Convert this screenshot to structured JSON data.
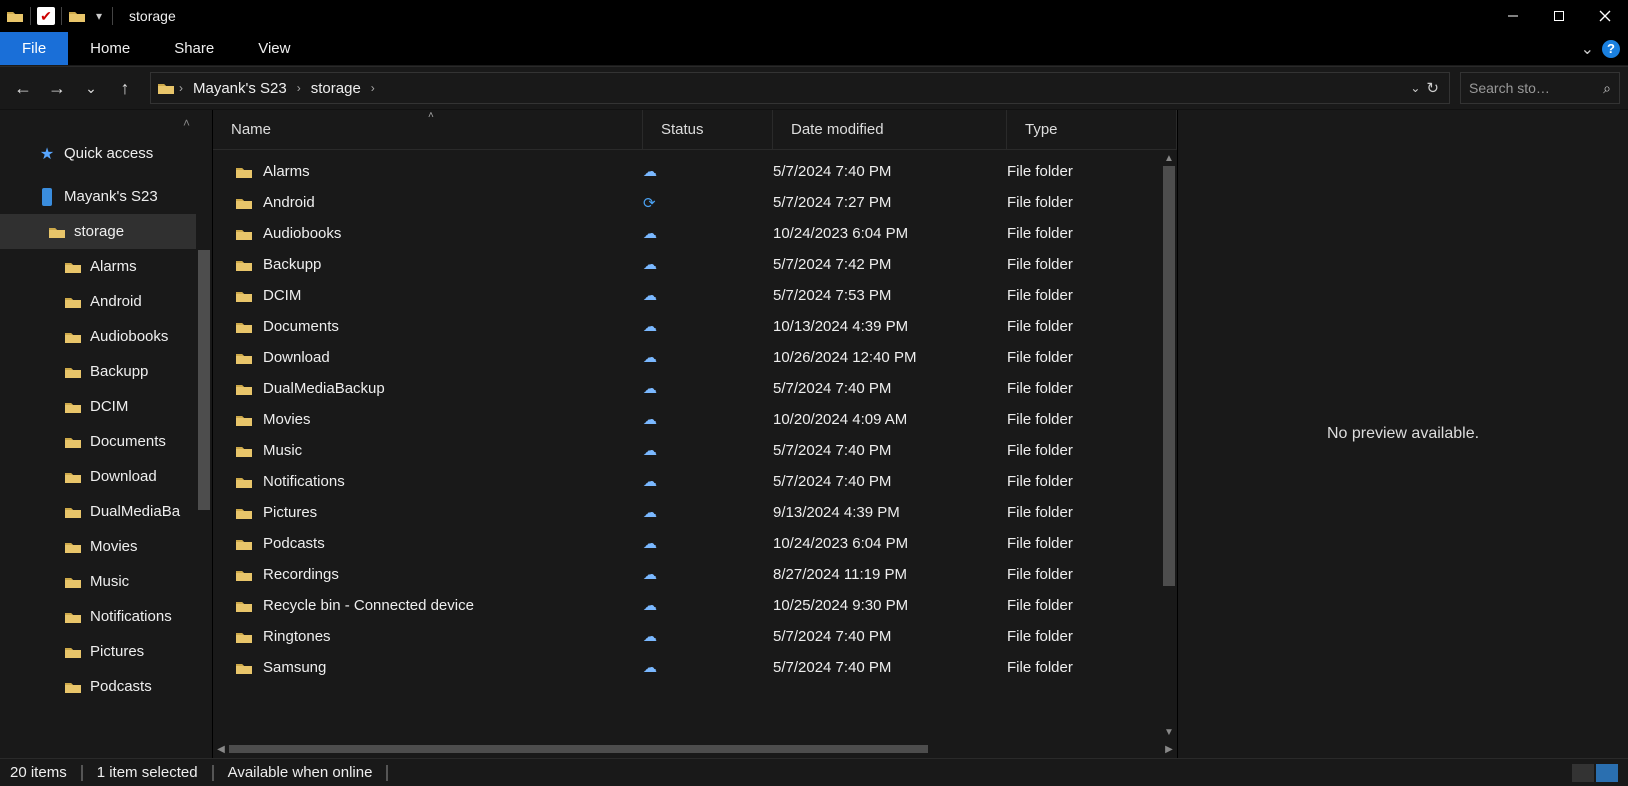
{
  "window": {
    "title": "storage"
  },
  "ribbon": {
    "file": "File",
    "tabs": [
      "Home",
      "Share",
      "View"
    ]
  },
  "breadcrumb": [
    "Mayank's S23",
    "storage"
  ],
  "search_placeholder": "Search sto…",
  "sidebar": {
    "quick_access": "Quick access",
    "device": "Mayank's S23",
    "storage": "storage",
    "children": [
      "Alarms",
      "Android",
      "Audiobooks",
      "Backupp",
      "DCIM",
      "Documents",
      "Download",
      "DualMediaBa",
      "Movies",
      "Music",
      "Notifications",
      "Pictures",
      "Podcasts"
    ]
  },
  "columns": {
    "name": "Name",
    "status": "Status",
    "date": "Date modified",
    "type": "Type"
  },
  "rows": [
    {
      "name": "Alarms",
      "status": "cloud",
      "date": "5/7/2024 7:40 PM",
      "type": "File folder"
    },
    {
      "name": "Android",
      "status": "sync",
      "date": "5/7/2024 7:27 PM",
      "type": "File folder"
    },
    {
      "name": "Audiobooks",
      "status": "cloud",
      "date": "10/24/2023 6:04 PM",
      "type": "File folder"
    },
    {
      "name": "Backupp",
      "status": "cloud",
      "date": "5/7/2024 7:42 PM",
      "type": "File folder"
    },
    {
      "name": "DCIM",
      "status": "cloud",
      "date": "5/7/2024 7:53 PM",
      "type": "File folder"
    },
    {
      "name": "Documents",
      "status": "cloud",
      "date": "10/13/2024 4:39 PM",
      "type": "File folder"
    },
    {
      "name": "Download",
      "status": "cloud",
      "date": "10/26/2024 12:40 PM",
      "type": "File folder"
    },
    {
      "name": "DualMediaBackup",
      "status": "cloud",
      "date": "5/7/2024 7:40 PM",
      "type": "File folder"
    },
    {
      "name": "Movies",
      "status": "cloud",
      "date": "10/20/2024 4:09 AM",
      "type": "File folder"
    },
    {
      "name": "Music",
      "status": "cloud",
      "date": "5/7/2024 7:40 PM",
      "type": "File folder"
    },
    {
      "name": "Notifications",
      "status": "cloud",
      "date": "5/7/2024 7:40 PM",
      "type": "File folder"
    },
    {
      "name": "Pictures",
      "status": "cloud",
      "date": "9/13/2024 4:39 PM",
      "type": "File folder"
    },
    {
      "name": "Podcasts",
      "status": "cloud",
      "date": "10/24/2023 6:04 PM",
      "type": "File folder"
    },
    {
      "name": "Recordings",
      "status": "cloud",
      "date": "8/27/2024 11:19 PM",
      "type": "File folder"
    },
    {
      "name": "Recycle bin - Connected device",
      "status": "cloud",
      "date": "10/25/2024 9:30 PM",
      "type": "File folder"
    },
    {
      "name": "Ringtones",
      "status": "cloud",
      "date": "5/7/2024 7:40 PM",
      "type": "File folder"
    },
    {
      "name": "Samsung",
      "status": "cloud",
      "date": "5/7/2024 7:40 PM",
      "type": "File folder"
    }
  ],
  "preview_text": "No preview available.",
  "status": {
    "items": "20 items",
    "selected": "1 item selected",
    "avail": "Available when online"
  }
}
